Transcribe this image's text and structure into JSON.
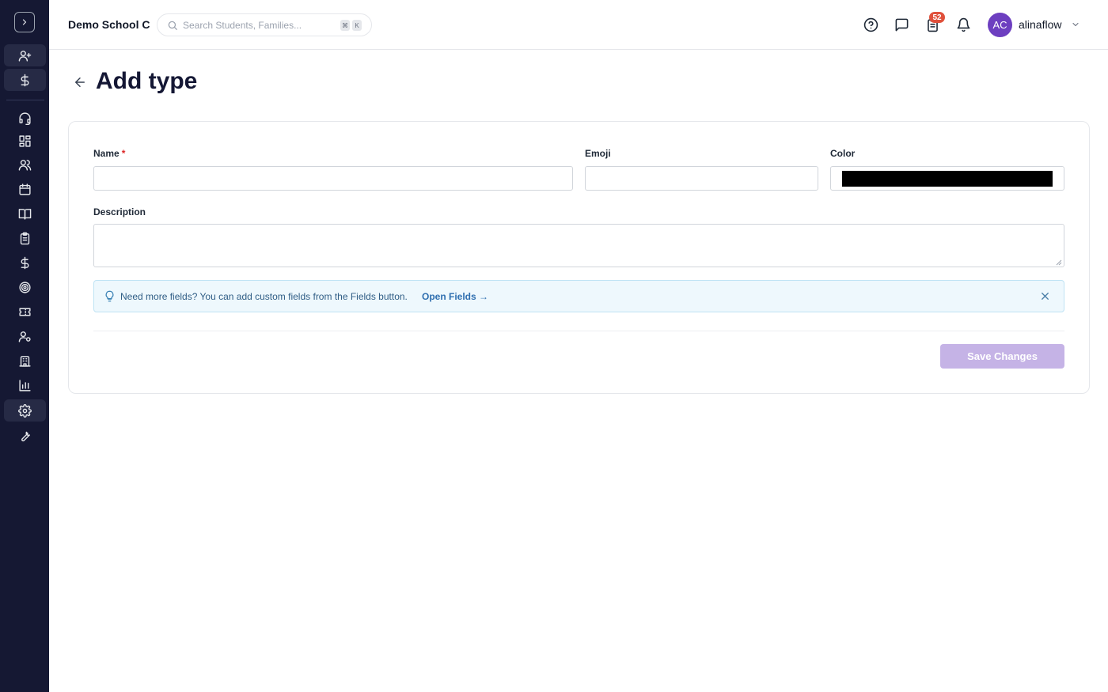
{
  "header": {
    "school_name": "Demo School C",
    "search": {
      "placeholder": "Search Students, Families...",
      "shortcut_keys": [
        "⌘",
        "K"
      ]
    },
    "notifications_count": "52",
    "user": {
      "initials": "AC",
      "name": "alinaflow"
    }
  },
  "page": {
    "title": "Add type"
  },
  "form": {
    "name_label": "Name",
    "required_mark": "*",
    "emoji_label": "Emoji",
    "color_label": "Color",
    "color_value": "#000000",
    "description_label": "Description",
    "hint_text": "Need more fields? You can add custom fields from the Fields button.",
    "hint_link": "Open Fields →",
    "save_label": "Save Changes"
  },
  "sidebar": {
    "icons": [
      "add-user-icon",
      "dollar-icon",
      "headset-icon",
      "dashboard-icon",
      "users-icon",
      "calendar-icon",
      "book-icon",
      "clipboard-icon",
      "dollar-icon",
      "target-icon",
      "ticket-icon",
      "user-settings-icon",
      "building-icon",
      "bar-chart-icon",
      "gear-icon",
      "wrench-icon"
    ]
  },
  "colors": {
    "sidebar_bg": "#151833",
    "accent": "#6d3fc0",
    "save_button_disabled": "#c5b3e6",
    "badge": "#e0503b"
  }
}
